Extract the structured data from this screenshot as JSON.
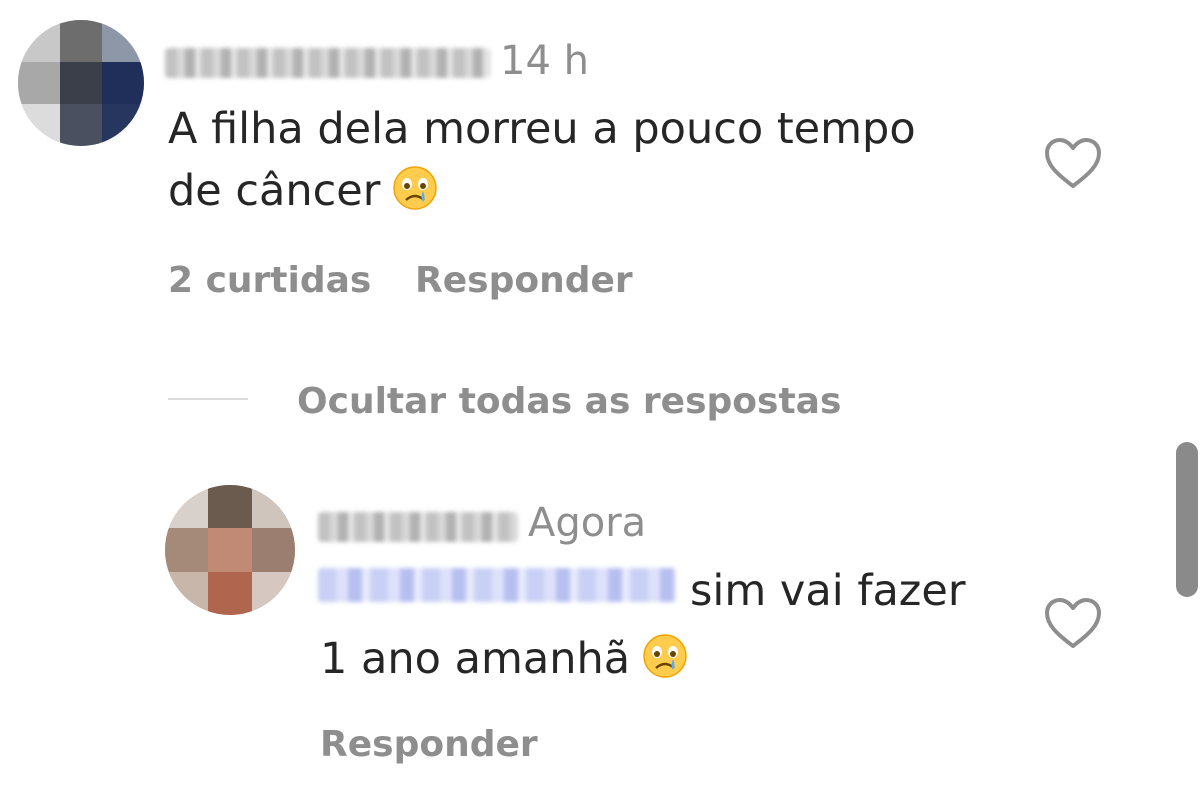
{
  "comment": {
    "time": "14 h",
    "text_line1": "A filha dela morreu a pouco tempo",
    "text_line2": "de câncer",
    "emoji": "crying-face-emoji",
    "likes": "2 curtidas",
    "reply_label": "Responder"
  },
  "replies_toggle": {
    "label": "Ocultar todas as respostas"
  },
  "reply": {
    "time": "Agora",
    "text_line1": "sim vai fazer",
    "text_line2": "1 ano amanhã",
    "emoji": "crying-face-emoji",
    "reply_label": "Responder"
  },
  "colors": {
    "text": "#262626",
    "secondary_text": "#8e8e8e",
    "divider": "#dbdbdb",
    "mention_blue": "#c9d0f5"
  }
}
